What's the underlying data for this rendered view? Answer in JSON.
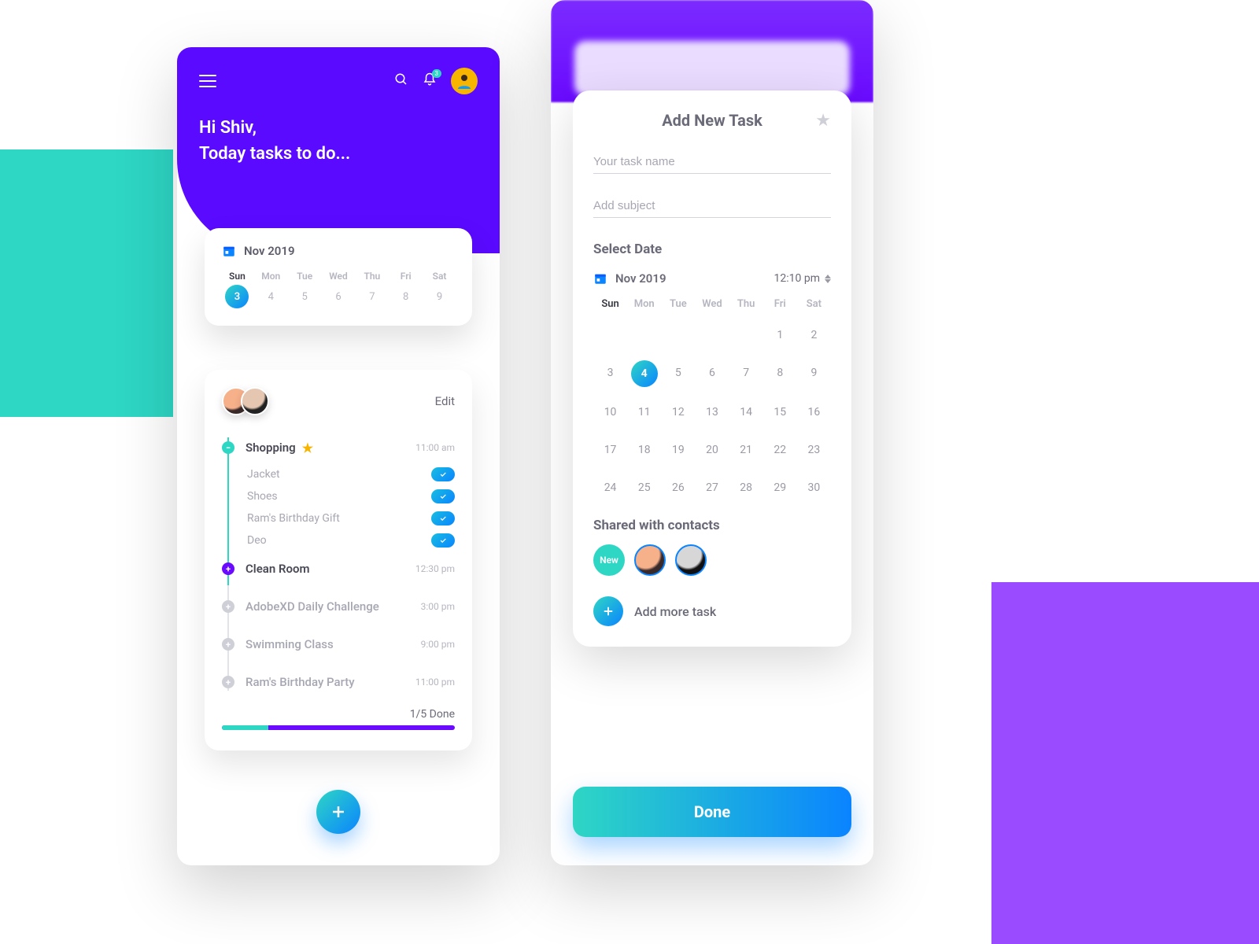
{
  "colors": {
    "purple": "#5a0aff",
    "teal": "#2ed6c4",
    "blue": "#0a84ff"
  },
  "left": {
    "greet_line1": "Hi Shiv,",
    "greet_line2": "Today tasks to do...",
    "notification_count": "3",
    "calendar": {
      "month": "Nov 2019",
      "day_labels": [
        "Sun",
        "Mon",
        "Tue",
        "Wed",
        "Thu",
        "Fri",
        "Sat"
      ],
      "dates": [
        "3",
        "4",
        "5",
        "6",
        "7",
        "8",
        "9"
      ],
      "selected": "3"
    },
    "tasks": {
      "edit": "Edit",
      "items": [
        {
          "name": "Shopping",
          "time": "11:00 am",
          "starred": true,
          "status": "done",
          "sub": [
            "Jacket",
            "Shoes",
            "Ram's Birthday Gift",
            "Deo"
          ]
        },
        {
          "name": "Clean Room",
          "time": "12:30 pm",
          "status": "current"
        },
        {
          "name": "AdobeXD Daily Challenge",
          "time": "3:00 pm",
          "status": "pending"
        },
        {
          "name": "Swimming Class",
          "time": "9:00 pm",
          "status": "pending"
        },
        {
          "name": "Ram's Birthday Party",
          "time": "11:00 pm",
          "status": "pending"
        }
      ],
      "progress": {
        "label": "1/5  Done",
        "percent": 20
      }
    }
  },
  "right": {
    "title": "Add New Task",
    "task_name_placeholder": "Your task name",
    "subject_placeholder": "Add subject",
    "select_date_label": "Select Date",
    "month": "Nov 2019",
    "time": "12:10 pm",
    "day_labels": [
      "Sun",
      "Mon",
      "Tue",
      "Wed",
      "Thu",
      "Fri",
      "Sat"
    ],
    "grid": [
      [
        "",
        "",
        "",
        "",
        "",
        "1",
        "2"
      ],
      [
        "3",
        "4",
        "5",
        "6",
        "7",
        "8",
        "9"
      ],
      [
        "10",
        "11",
        "12",
        "13",
        "14",
        "15",
        "16"
      ],
      [
        "17",
        "18",
        "19",
        "20",
        "21",
        "22",
        "23"
      ],
      [
        "24",
        "25",
        "26",
        "27",
        "28",
        "29",
        "30"
      ]
    ],
    "selected_date": "4",
    "shared_label": "Shared with contacts",
    "new_label": "New",
    "add_more_label": "Add more task",
    "done_label": "Done"
  }
}
